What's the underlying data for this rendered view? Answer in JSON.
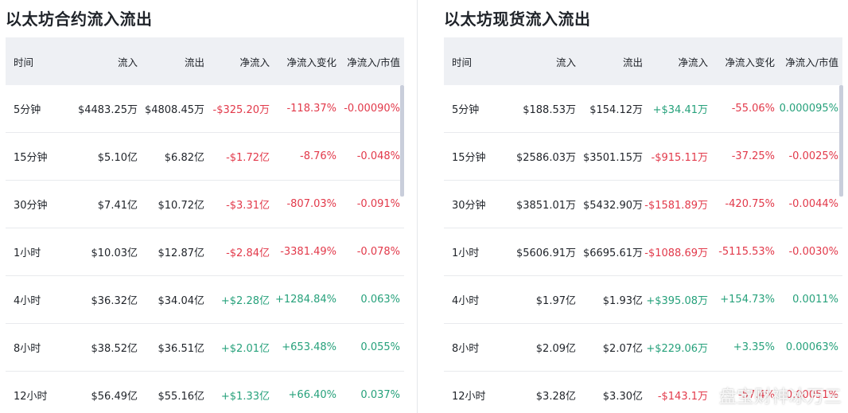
{
  "left": {
    "title": "以太坊合约流入流出",
    "headers": [
      "时间",
      "流入",
      "流出",
      "净流入",
      "净流入变化",
      "净流入/市值"
    ],
    "rows": [
      [
        "5分钟",
        "$4483.25万",
        "$4808.45万",
        "-$325.20万",
        "-118.37%",
        "-0.00090%"
      ],
      [
        "15分钟",
        "$5.10亿",
        "$6.82亿",
        "-$1.72亿",
        "-8.76%",
        "-0.048%"
      ],
      [
        "30分钟",
        "$7.41亿",
        "$10.72亿",
        "-$3.31亿",
        "-807.03%",
        "-0.091%"
      ],
      [
        "1小时",
        "$10.03亿",
        "$12.87亿",
        "-$2.84亿",
        "-3381.49%",
        "-0.078%"
      ],
      [
        "4小时",
        "$36.32亿",
        "$34.04亿",
        "+$2.28亿",
        "+1284.84%",
        "0.063%"
      ],
      [
        "8小时",
        "$38.52亿",
        "$36.51亿",
        "+$2.01亿",
        "+653.48%",
        "0.055%"
      ],
      [
        "12小时",
        "$56.49亿",
        "$55.16亿",
        "+$1.33亿",
        "+66.40%",
        "0.037%"
      ]
    ],
    "row_trend": [
      "down",
      "down",
      "down",
      "down",
      "up",
      "up",
      "up"
    ]
  },
  "right": {
    "title": "以太坊现货流入流出",
    "headers": [
      "时间",
      "流入",
      "流出",
      "净流入",
      "净流入变化",
      "净流入/市值"
    ],
    "rows": [
      [
        "5分钟",
        "$188.53万",
        "$154.12万",
        "+$34.41万",
        "-55.06%",
        "0.000095%"
      ],
      [
        "15分钟",
        "$2586.03万",
        "$3501.15万",
        "-$915.11万",
        "-37.25%",
        "-0.0025%"
      ],
      [
        "30分钟",
        "$3851.01万",
        "$5432.90万",
        "-$1581.89万",
        "-420.75%",
        "-0.0044%"
      ],
      [
        "1小时",
        "$5606.91万",
        "$6695.61万",
        "-$1088.69万",
        "-5115.53%",
        "-0.0030%"
      ],
      [
        "4小时",
        "$1.97亿",
        "$1.93亿",
        "+$395.08万",
        "+154.73%",
        "0.0011%"
      ],
      [
        "8小时",
        "$2.09亿",
        "$2.07亿",
        "+$229.06万",
        "+3.35%",
        "0.00063%"
      ],
      [
        "12小时",
        "$3.28亿",
        "$3.30亿",
        "-$143.1万",
        "-57.4%",
        "-0.00051%"
      ]
    ],
    "cell_trend": [
      [
        "",
        "",
        "",
        "up",
        "down",
        "up"
      ],
      [
        "",
        "",
        "",
        "down",
        "down",
        "down"
      ],
      [
        "",
        "",
        "",
        "down",
        "down",
        "down"
      ],
      [
        "",
        "",
        "",
        "down",
        "down",
        "down"
      ],
      [
        "",
        "",
        "",
        "up",
        "up",
        "up"
      ],
      [
        "",
        "",
        "",
        "up",
        "up",
        "up"
      ],
      [
        "",
        "",
        "",
        "down",
        "down",
        "down"
      ]
    ]
  },
  "watermark": "盘宝财神冰万三",
  "colors": {
    "up": "#26a17b",
    "down": "#e2394a",
    "header_bg": "#eef0f4"
  }
}
